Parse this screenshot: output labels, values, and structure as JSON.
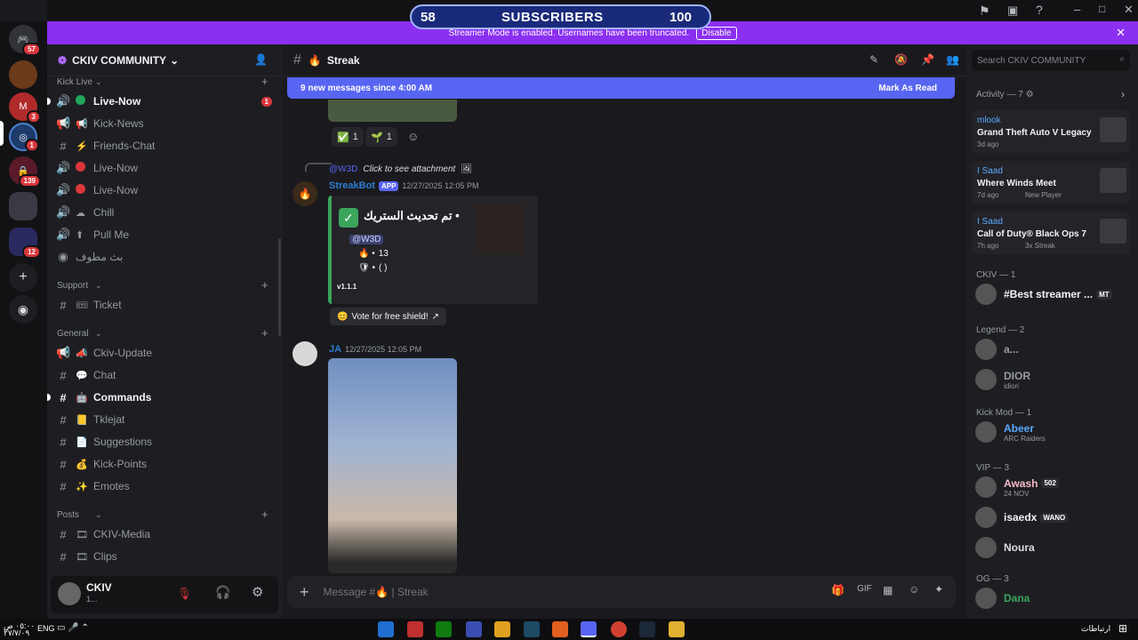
{
  "overlay": {
    "left": "58",
    "title": "SUBSCRIBERS",
    "right": "100",
    "behind": "COMMUNITY"
  },
  "streamer": {
    "text": "Streamer Mode is enabled. Usernames have been truncated.",
    "disable": "Disable"
  },
  "rail": {
    "badges": [
      "57",
      "3",
      "1",
      "139",
      "12"
    ]
  },
  "server": {
    "name": "CKIV COMMUNITY"
  },
  "categories": [
    {
      "name": "Kick Live",
      "channels": [
        {
          "icon": "speaker",
          "emoji": "green-dot",
          "name": "Live-Now",
          "unread": true,
          "mention": "1"
        },
        {
          "icon": "announce",
          "emoji": "megaphone",
          "name": "Kick-News"
        },
        {
          "icon": "hash",
          "emoji": "zap",
          "name": "Friends-Chat"
        },
        {
          "icon": "speaker",
          "emoji": "red-dot",
          "name": "Live-Now"
        },
        {
          "icon": "speaker",
          "emoji": "red-dot",
          "name": "Live-Now"
        },
        {
          "icon": "speaker",
          "emoji": "cloud",
          "name": "Chill"
        },
        {
          "icon": "speaker",
          "emoji": "up-arrow",
          "name": "Pull Me"
        },
        {
          "icon": "stage",
          "emoji": "",
          "name": "بث مطوف"
        }
      ]
    },
    {
      "name": "Support",
      "channels": [
        {
          "icon": "hash",
          "emoji": "ticket",
          "name": "Ticket"
        }
      ]
    },
    {
      "name": "General",
      "channels": [
        {
          "icon": "announce",
          "emoji": "flag",
          "name": "Ckiv-Update"
        },
        {
          "icon": "hash",
          "emoji": "chat",
          "name": "Chat"
        },
        {
          "icon": "hash",
          "emoji": "robot",
          "name": "Commands",
          "unread": true
        },
        {
          "icon": "hash",
          "emoji": "note",
          "name": "Tklejat"
        },
        {
          "icon": "hash",
          "emoji": "page",
          "name": "Suggestions"
        },
        {
          "icon": "hash",
          "emoji": "coin",
          "name": "Kick-Points"
        },
        {
          "icon": "hash",
          "emoji": "sparkles",
          "name": "Emotes"
        }
      ]
    },
    {
      "name": "Posts",
      "channels": [
        {
          "icon": "hash",
          "emoji": "frames",
          "name": "CKIV-Media"
        },
        {
          "icon": "hash",
          "emoji": "frames",
          "name": "Clips"
        }
      ]
    }
  ],
  "user": {
    "name": "CKIV",
    "status": "1..."
  },
  "chat": {
    "channel": "Streak",
    "newmsgs": "9 new messages since 4:00 AM",
    "mark": "Mark As Read",
    "reactions": [
      {
        "e": "✅",
        "c": "1"
      },
      {
        "e": "🌱",
        "c": "1"
      }
    ],
    "reply": {
      "user": "@W3D",
      "text": "Click to see attachment"
    },
    "msg1": {
      "author": "StreakBot",
      "app": "APP",
      "time": "12/27/2025 12:05 PM",
      "embed": {
        "title": "تم تحديث الستريك •",
        "mention": "@W3D",
        "streak": "13",
        "shield": "( )",
        "version": "v1.1.1"
      },
      "button": "Vote for free shield!"
    },
    "msg2": {
      "author": "JA",
      "time": "12/27/2025 12:05 PM"
    },
    "placeholder": "Message #🔥 | Streak"
  },
  "members": {
    "search": "Search CKIV COMMUNITY",
    "activity": "Activity — 7",
    "activities": [
      {
        "user": "mlook",
        "game": "Grand Theft Auto V Legacy",
        "time": "3d ago",
        "extra": ""
      },
      {
        "user": "I Saad",
        "game": "Where Winds Meet",
        "time": "7d ago",
        "extra": "New Player"
      },
      {
        "user": "I Saad",
        "game": "Call of Duty® Black Ops 7",
        "time": "7h ago",
        "extra": "3x Streak"
      }
    ],
    "groups": [
      {
        "name": "CKIV — 1",
        "members": [
          {
            "name": "#Best streamer ...",
            "tag": "MT",
            "sub": "",
            "color": "#f2f3f5"
          }
        ]
      },
      {
        "name": "Legend — 2",
        "members": [
          {
            "name": "a...",
            "tag": "",
            "sub": "",
            "color": "#949ba4"
          },
          {
            "name": "DIOR",
            "tag": "",
            "sub": "idiori",
            "color": "#949ba4"
          }
        ]
      },
      {
        "name": "Kick Mod — 1",
        "members": [
          {
            "name": "Abeer",
            "tag": "",
            "sub": "ARC Raiders",
            "color": "#5aa9ff"
          }
        ]
      },
      {
        "name": "VIP — 3",
        "members": [
          {
            "name": "Awash",
            "tag": "502",
            "sub": "24 NOV",
            "color": "#f4b8c8"
          },
          {
            "name": "isaedx",
            "tag": "WANO",
            "sub": "",
            "color": "#f2f3f5"
          },
          {
            "name": "Noura",
            "tag": "",
            "sub": "",
            "color": "#dbdee1"
          }
        ]
      },
      {
        "name": "OG — 3",
        "members": [
          {
            "name": "Dana",
            "tag": "",
            "sub": "",
            "color": "#3ba55c"
          }
        ]
      }
    ]
  },
  "taskbar": {
    "lang": "ENG",
    "time": "٠٥:٠٠ ص",
    "date": "٢٧/٧/٠٩",
    "notif": "ارتباطات"
  }
}
